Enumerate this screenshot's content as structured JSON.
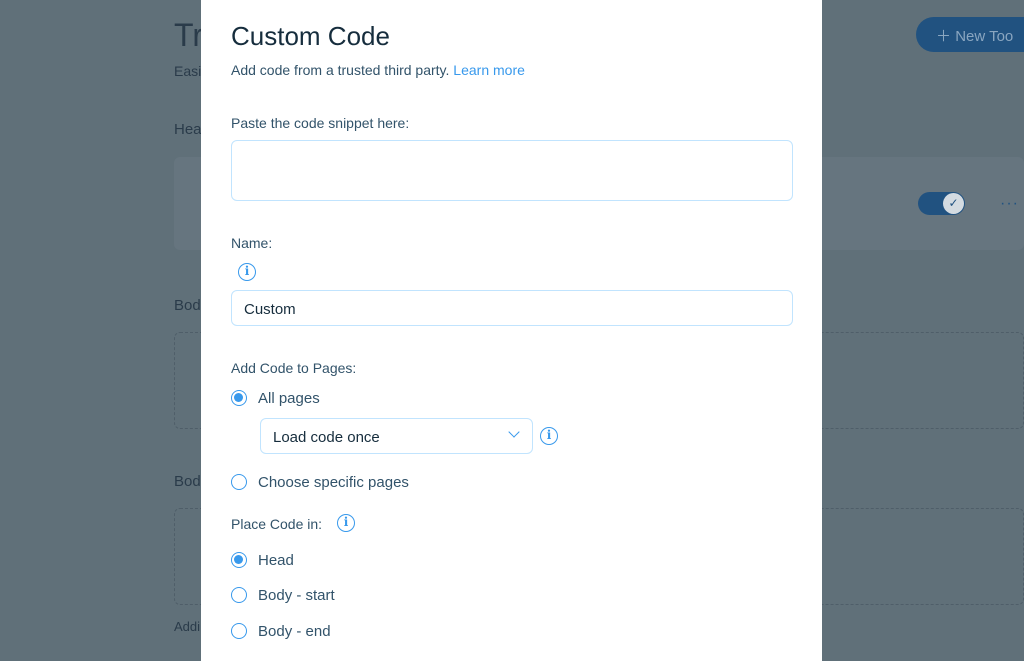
{
  "background": {
    "title": "Tr",
    "subtitle": "Easi",
    "section_head": "Hea",
    "section_body1": "Bod",
    "section_body2": "Bod",
    "footer_text": "Addi",
    "new_tool_button": "New Too",
    "toggle_on": true,
    "more_icon": "ellipsis-icon"
  },
  "modal": {
    "title": "Custom Code",
    "subtitle": "Add code from a trusted third party.",
    "learn_more": "Learn more",
    "snippet_label": "Paste the code snippet here:",
    "snippet_value": "",
    "name_label": "Name:",
    "name_value": "Custom",
    "pages_label": "Add Code to Pages:",
    "pages_options": [
      {
        "label": "All pages",
        "selected": true
      },
      {
        "label": "Choose specific pages",
        "selected": false
      }
    ],
    "load_select": "Load code once",
    "place_label": "Place Code in:",
    "place_options": [
      {
        "label": "Head",
        "selected": true
      },
      {
        "label": "Body - start",
        "selected": false
      },
      {
        "label": "Body - end",
        "selected": false
      }
    ],
    "accent": "#3899ec"
  }
}
